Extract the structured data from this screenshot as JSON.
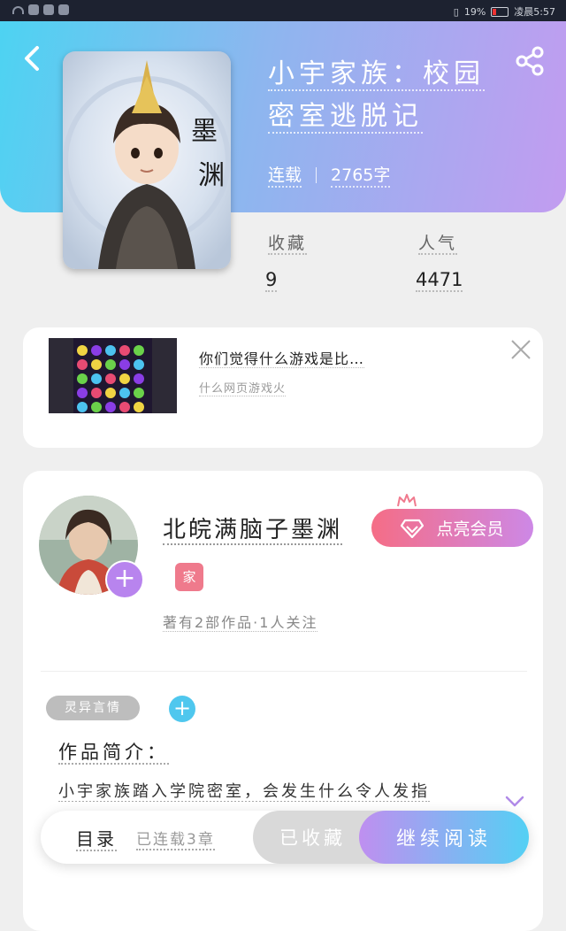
{
  "status_bar": {
    "battery_text": "19%",
    "time_text": "凌晨5:57",
    "colors": {
      "background": "#1d2230"
    }
  },
  "header": {
    "colors": {
      "gradient_start": "#4dd3f2",
      "gradient_end": "#c29cf0"
    }
  },
  "book": {
    "title_line1": "小宇家族：校园",
    "title_line2": "密室逃脱记",
    "status": "连载",
    "word_count": "2765字",
    "cover_char_top": "墨",
    "cover_char_bottom": "渊",
    "stats": {
      "favorites_label": "收藏",
      "favorites_value": "9",
      "popularity_label": "人气",
      "popularity_value": "4471"
    }
  },
  "ad": {
    "title": "你们觉得什么游戏是比…",
    "subtitle": "什么网页游戏火"
  },
  "author": {
    "name": "北皖满脑子墨渊",
    "vip_label": "点亮会员",
    "badge": "家",
    "stats": "著有2部作品·1人关注"
  },
  "work": {
    "tag": "灵异言情",
    "intro_label": "作品简介：",
    "intro_text": "小宇家族踏入学院密室，会发生什么令人发指"
  },
  "bottom_bar": {
    "toc_label": "目录",
    "serial_status": "已连载3章",
    "collected_label": "已收藏",
    "read_label": "继续阅读"
  }
}
